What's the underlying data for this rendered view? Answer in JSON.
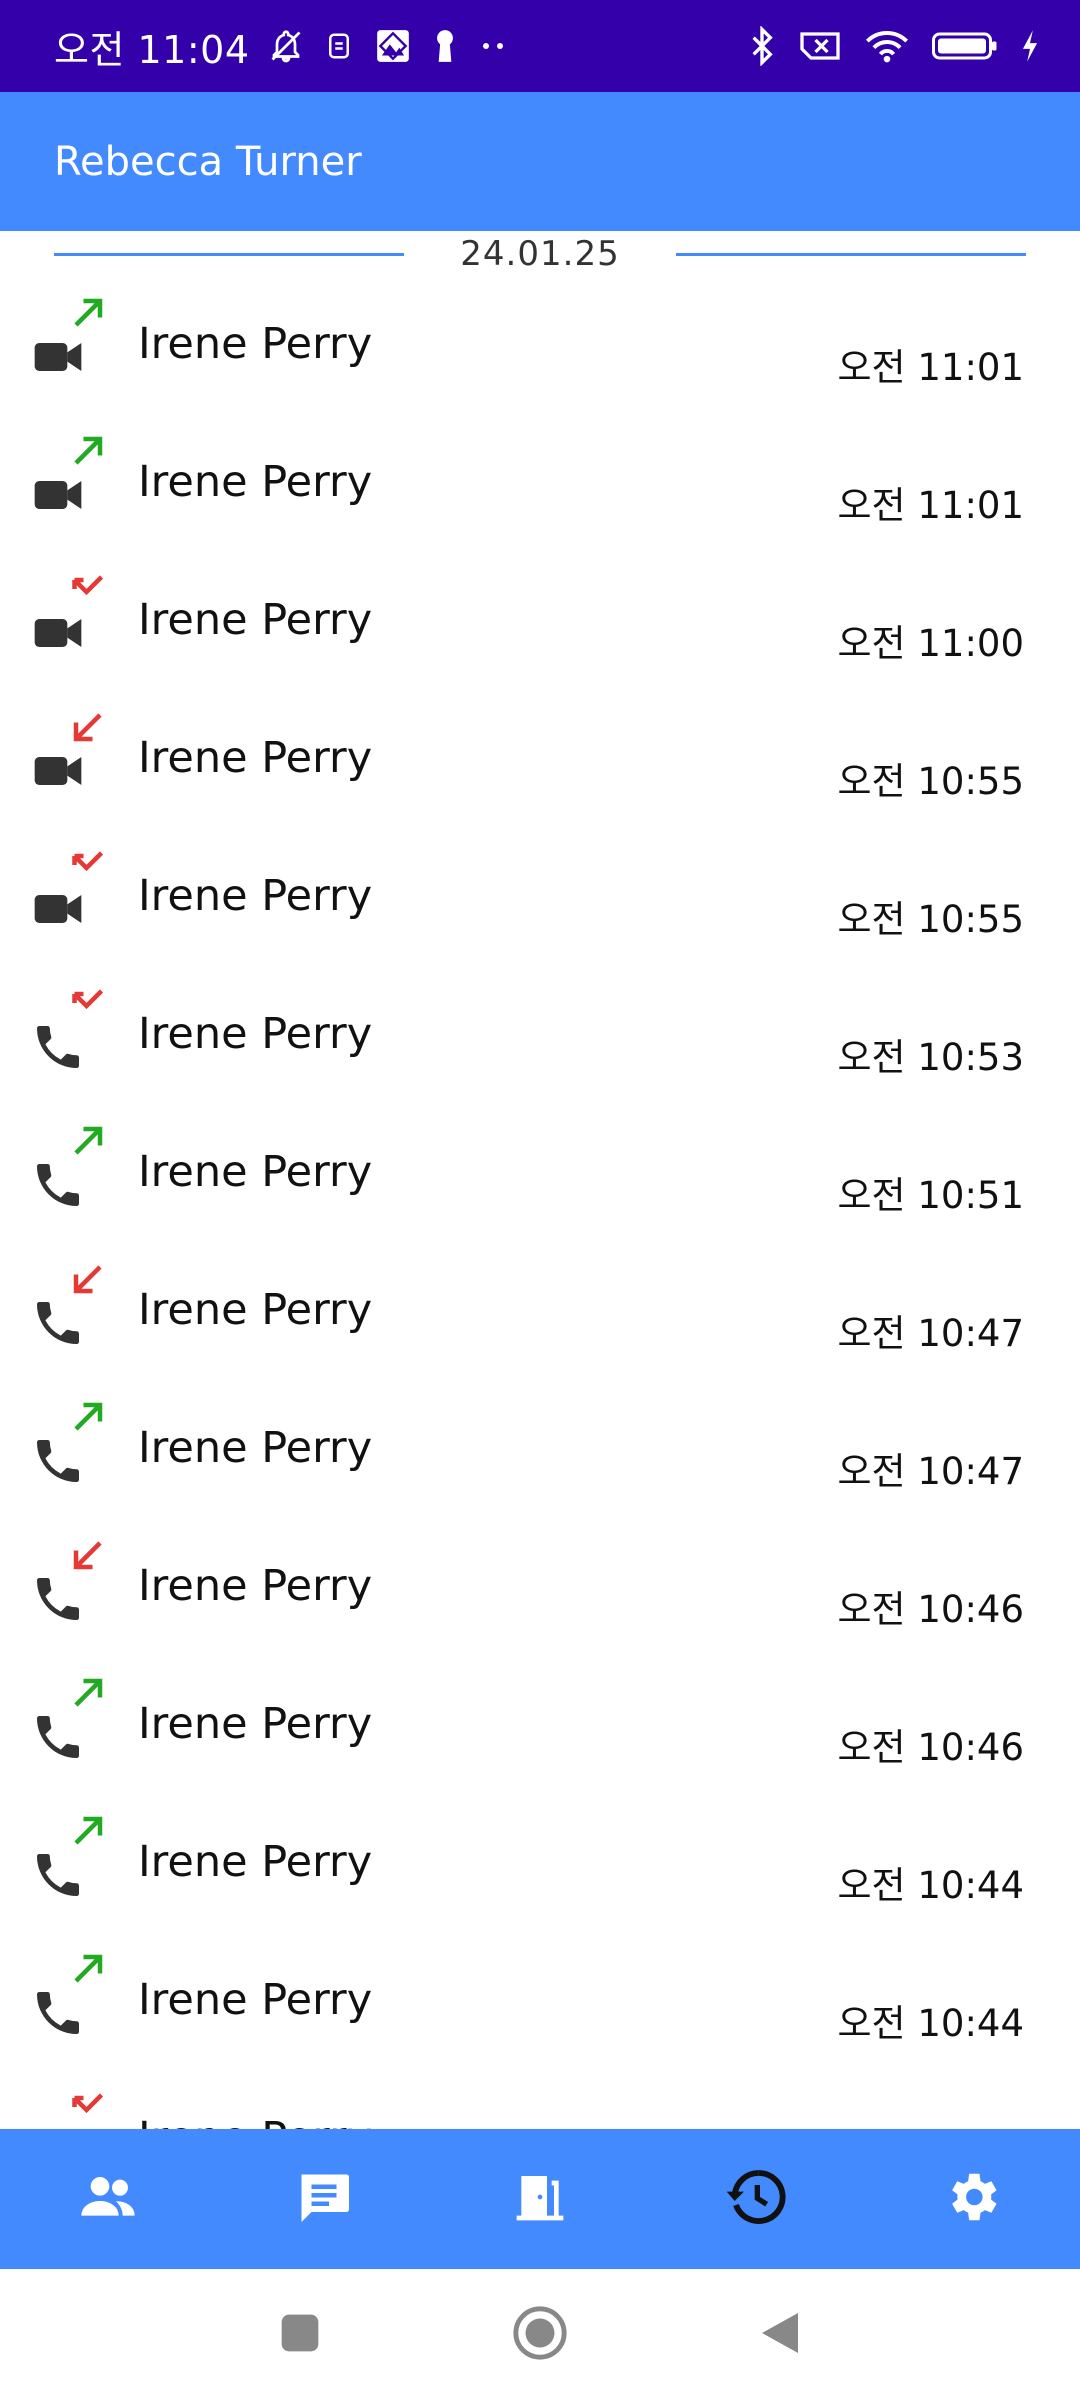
{
  "status_bar": {
    "time": "오전 11:04",
    "icons_left": [
      "notifications-off-icon",
      "sim-icon",
      "gallery-icon",
      "keyhole-icon",
      "more-dots-icon"
    ],
    "icons_right": [
      "bluetooth-icon",
      "no-sim-icon",
      "wifi-icon",
      "battery-icon",
      "charging-icon"
    ]
  },
  "app_bar": {
    "title": "Rebecca Turner"
  },
  "date_divider": {
    "date": "24.01.25"
  },
  "calls": [
    {
      "name": "Irene Perry",
      "time": "오전 11:01",
      "type": "video-call-icon",
      "direction": "outgoing-arrow-icon",
      "direction_color": "#22aa22"
    },
    {
      "name": "Irene Perry",
      "time": "오전 11:01",
      "type": "video-call-icon",
      "direction": "outgoing-arrow-icon",
      "direction_color": "#22aa22"
    },
    {
      "name": "Irene Perry",
      "time": "오전 11:00",
      "type": "video-call-icon",
      "direction": "missed-arrow-icon",
      "direction_color": "#e53935"
    },
    {
      "name": "Irene Perry",
      "time": "오전 10:55",
      "type": "video-call-icon",
      "direction": "incoming-arrow-icon",
      "direction_color": "#e53935"
    },
    {
      "name": "Irene Perry",
      "time": "오전 10:55",
      "type": "video-call-icon",
      "direction": "missed-arrow-icon",
      "direction_color": "#e53935"
    },
    {
      "name": "Irene Perry",
      "time": "오전 10:53",
      "type": "phone-call-icon",
      "direction": "missed-arrow-icon",
      "direction_color": "#e53935"
    },
    {
      "name": "Irene Perry",
      "time": "오전 10:51",
      "type": "phone-call-icon",
      "direction": "outgoing-arrow-icon",
      "direction_color": "#22aa22"
    },
    {
      "name": "Irene Perry",
      "time": "오전 10:47",
      "type": "phone-call-icon",
      "direction": "incoming-arrow-icon",
      "direction_color": "#e53935"
    },
    {
      "name": "Irene Perry",
      "time": "오전 10:47",
      "type": "phone-call-icon",
      "direction": "outgoing-arrow-icon",
      "direction_color": "#22aa22"
    },
    {
      "name": "Irene Perry",
      "time": "오전 10:46",
      "type": "phone-call-icon",
      "direction": "incoming-arrow-icon",
      "direction_color": "#e53935"
    },
    {
      "name": "Irene Perry",
      "time": "오전 10:46",
      "type": "phone-call-icon",
      "direction": "outgoing-arrow-icon",
      "direction_color": "#22aa22"
    },
    {
      "name": "Irene Perry",
      "time": "오전 10:44",
      "type": "phone-call-icon",
      "direction": "outgoing-arrow-icon",
      "direction_color": "#22aa22"
    },
    {
      "name": "Irene Perry",
      "time": "오전 10:44",
      "type": "phone-call-icon",
      "direction": "outgoing-arrow-icon",
      "direction_color": "#22aa22"
    },
    {
      "name": "Irene Perry",
      "time": "",
      "type": "phone-call-icon",
      "direction": "missed-arrow-icon",
      "direction_color": "#e53935"
    }
  ],
  "bottom_nav": {
    "items": [
      {
        "icon": "contacts-icon",
        "active": false
      },
      {
        "icon": "messages-icon",
        "active": false
      },
      {
        "icon": "door-icon",
        "active": false
      },
      {
        "icon": "call-history-icon",
        "active": true
      },
      {
        "icon": "settings-gear-icon",
        "active": false
      }
    ],
    "active_color": "#111111",
    "inactive_color": "#ffffff"
  },
  "system_nav": {
    "icons": [
      "recents-square-icon",
      "home-circle-icon",
      "back-triangle-icon"
    ]
  },
  "colors": {
    "status_bar": "#3300aa",
    "accent": "#448aff",
    "outgoing": "#22aa22",
    "incoming": "#e53935"
  }
}
